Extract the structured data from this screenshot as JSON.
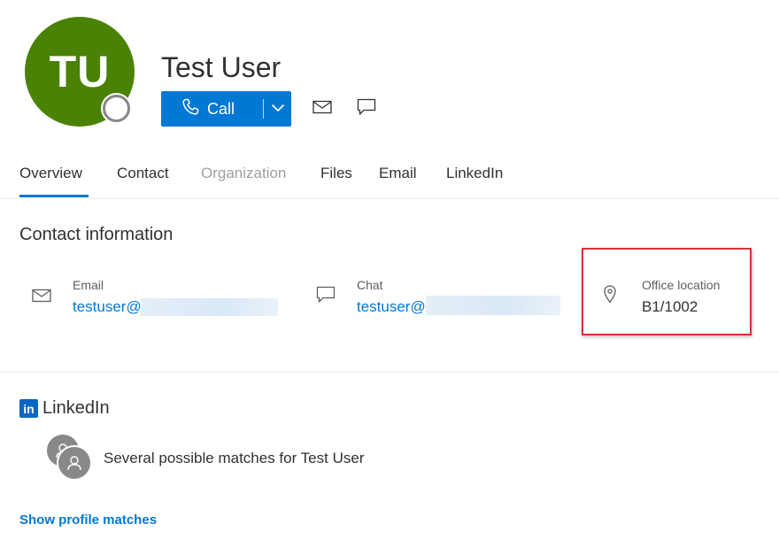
{
  "profile": {
    "initials": "TU",
    "name": "Test User",
    "avatar_color": "#498205",
    "presence": "offline"
  },
  "actions": {
    "call_label": "Call",
    "call_icon": "phone-icon",
    "dropdown_icon": "chevron-down-icon",
    "email_icon": "mail-icon",
    "chat_icon": "chat-icon"
  },
  "tabs": [
    {
      "label": "Overview",
      "active": true
    },
    {
      "label": "Contact"
    },
    {
      "label": "Organization",
      "disabled": true
    },
    {
      "label": "Files"
    },
    {
      "label": "Email"
    },
    {
      "label": "LinkedIn"
    }
  ],
  "contact": {
    "title": "Contact information",
    "email": {
      "label": "Email",
      "value": "testuser@",
      "icon": "mail-icon"
    },
    "chat": {
      "label": "Chat",
      "value": "testuser@",
      "icon": "chat-icon"
    },
    "office": {
      "label": "Office location",
      "value": "B1/1002",
      "icon": "location-pin-icon"
    }
  },
  "linkedin": {
    "logo": "in",
    "title": "LinkedIn",
    "matches_text": "Several possible matches for Test User",
    "show_link": "Show profile matches"
  },
  "colors": {
    "accent": "#0078d4",
    "highlight": "#d13438",
    "linkedin": "#0a66c2"
  }
}
